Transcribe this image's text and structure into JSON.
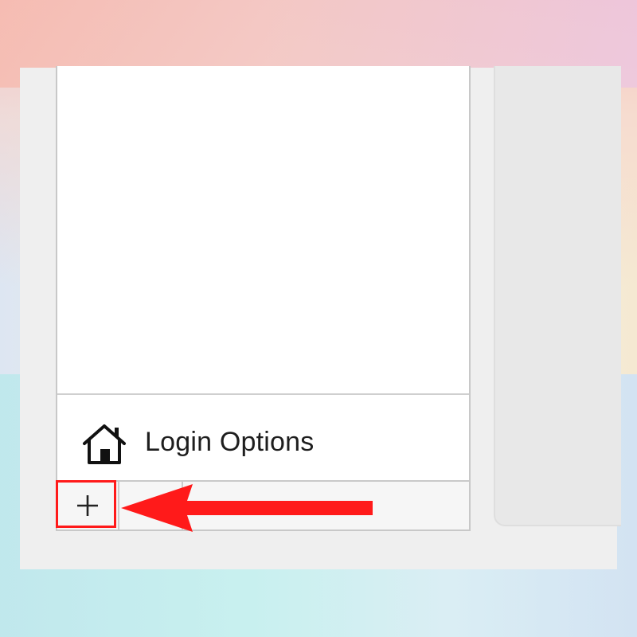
{
  "users_panel": {
    "login_options_label": "Login Options",
    "login_options_icon": "house-icon"
  },
  "toolbar": {
    "add_icon": "plus-icon",
    "add_symbol": "+"
  },
  "annotation": {
    "color": "#ff1a1a",
    "highlight": "add-button",
    "pointer": "left-arrow"
  }
}
